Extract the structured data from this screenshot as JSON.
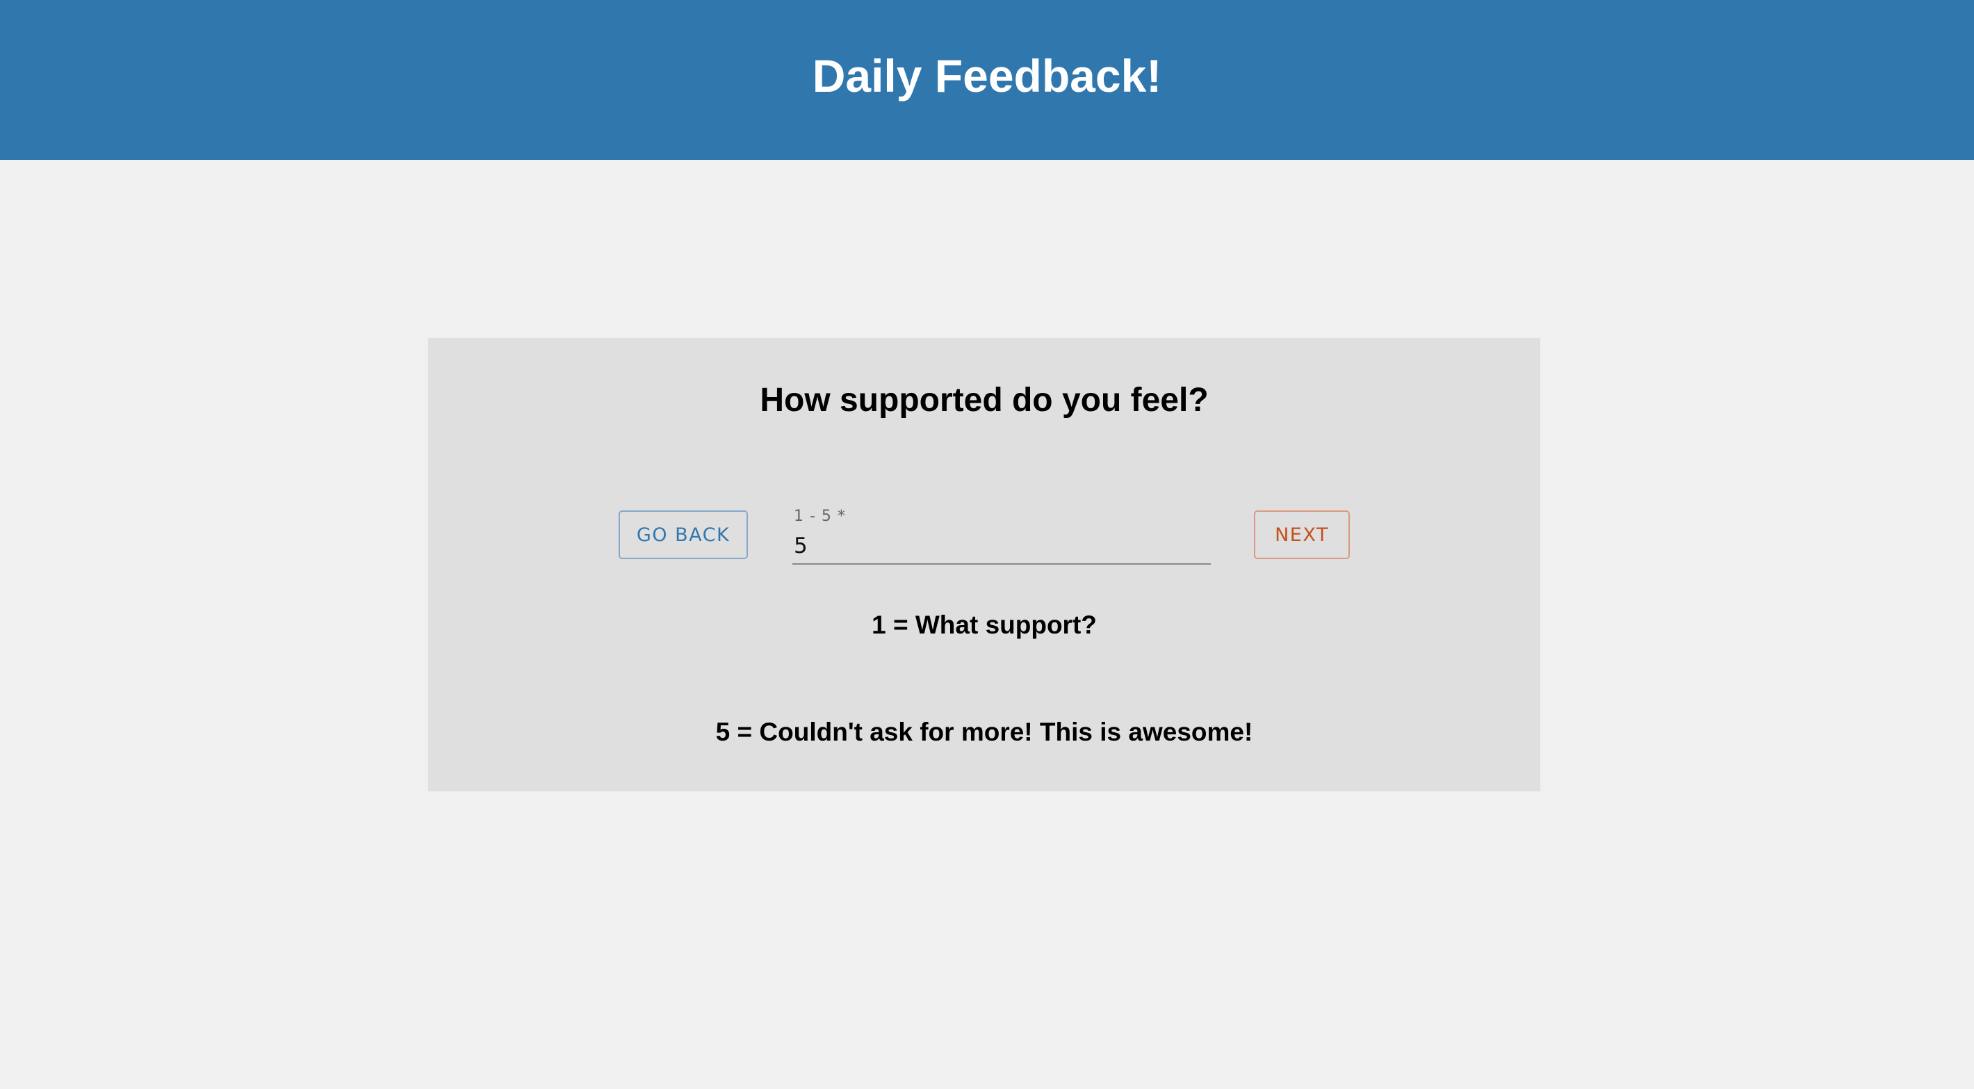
{
  "header": {
    "title": "Daily Feedback!"
  },
  "question": {
    "text": "How supported do you feel?"
  },
  "buttons": {
    "back_label": "GO BACK",
    "next_label": "NEXT"
  },
  "rating_field": {
    "label": "1 - 5 *",
    "value": "5"
  },
  "scale": {
    "low": "1 = What support?",
    "high": "5 = Couldn't ask for more! This is awesome!"
  },
  "colors": {
    "header_bg": "#3077ae",
    "page_bg": "#f0f0f0",
    "card_bg": "#dfdfdf",
    "back_button": "#3077ae",
    "next_button": "#c4501d"
  }
}
